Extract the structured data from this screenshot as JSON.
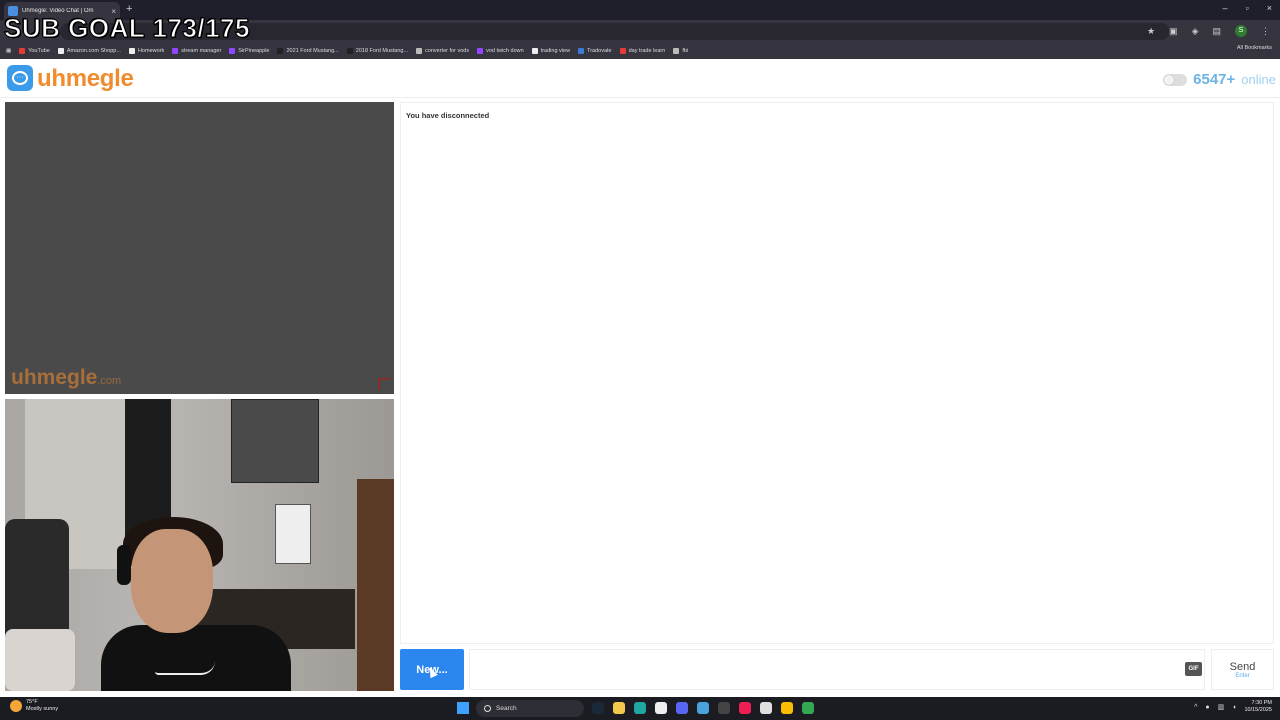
{
  "browser": {
    "tab_title": "Uhmegle: Video Chat | Om",
    "tab_close": "×",
    "new_tab": "+",
    "window_controls": [
      "–",
      "▫",
      "×"
    ],
    "profile_initial": "S",
    "bookmarks": [
      {
        "label": "YouTube",
        "color": "#e53935"
      },
      {
        "label": "Amazon.com Shopp...",
        "color": "#eeeeee"
      },
      {
        "label": "Homework",
        "color": "#eeeeee"
      },
      {
        "label": "stream manager",
        "color": "#9146ff"
      },
      {
        "label": "SirPineapple",
        "color": "#9146ff"
      },
      {
        "label": "2021 Ford Mustang...",
        "color": "#222222"
      },
      {
        "label": "2018 Ford Mustang...",
        "color": "#222222"
      },
      {
        "label": "converter for vods",
        "color": "#bbbbbb"
      },
      {
        "label": "vod twich down",
        "color": "#9146ff"
      },
      {
        "label": "trading view",
        "color": "#eeeeee"
      },
      {
        "label": "Tradovate",
        "color": "#3a7bd5"
      },
      {
        "label": "day trade learn",
        "color": "#e53935"
      },
      {
        "label": "fbi",
        "color": "#bbbbbb"
      }
    ],
    "all_bookmarks": "All Bookmarks"
  },
  "overlay": {
    "sub_goal": "SUB GOAL 173/175"
  },
  "header": {
    "logo_text": "uhmegle",
    "online_count": "6547+",
    "online_label": "online"
  },
  "video": {
    "watermark": "uhmegle",
    "watermark_suffix": ".com"
  },
  "chat": {
    "status": "You have disconnected",
    "new_button": "New...",
    "input_placeholder": "",
    "gif_label": "GIF",
    "send_label": "Send",
    "send_hint": "Enter"
  },
  "taskbar": {
    "temperature": "75°F",
    "weather": "Mostly sunny",
    "search_label": "Search",
    "time": "7:30 PM",
    "date": "10/15/2025",
    "apps": [
      {
        "name": "steam-icon",
        "color": "#1b2838"
      },
      {
        "name": "folder-icon",
        "color": "#f2c94c"
      },
      {
        "name": "edge-icon",
        "color": "#1fa5a2"
      },
      {
        "name": "store-icon",
        "color": "#eeeeee"
      },
      {
        "name": "discord-icon",
        "color": "#5865f2"
      },
      {
        "name": "photos-icon",
        "color": "#4aa3df"
      },
      {
        "name": "obs-icon",
        "color": "#444444"
      },
      {
        "name": "tiktok-icon",
        "color": "#ee1d52"
      },
      {
        "name": "app-icon",
        "color": "#e0e0e0"
      },
      {
        "name": "chrome-icon",
        "color": "#fbbc05"
      },
      {
        "name": "chrome-profile-icon",
        "color": "#34a853"
      }
    ]
  }
}
